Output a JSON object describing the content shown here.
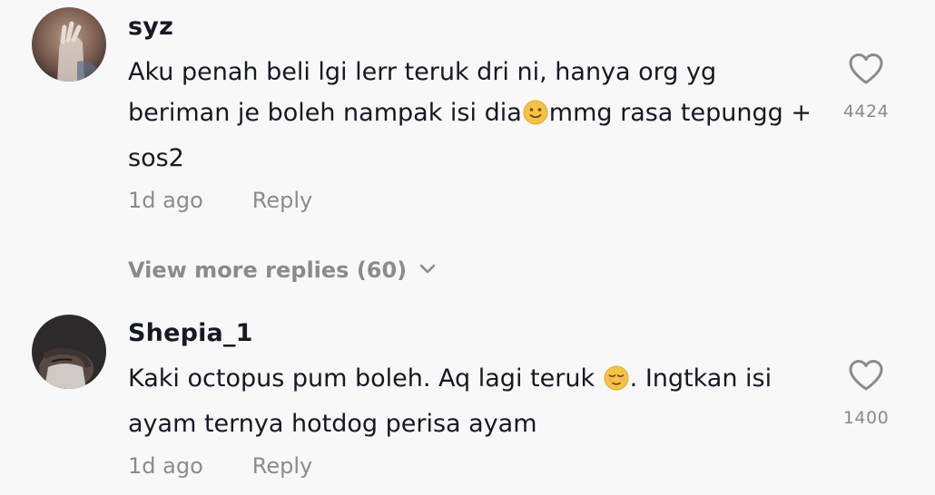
{
  "comments": [
    {
      "username": "syz",
      "text_before_emoji": "Aku penah beli lgi lerr teruk dri ni, hanya org yg beriman je boleh nampak isi dia",
      "emoji": "slightly-smiling-face",
      "text_after_emoji": "mmg rasa tepungg + sos2",
      "time": "1d ago",
      "reply_label": "Reply",
      "likes": "4424",
      "replies_label": "View more replies (60)"
    },
    {
      "username": "Shepia_1",
      "text_before_emoji": "Kaki octopus pum boleh. Aq lagi teruk ",
      "emoji": "relieved-face",
      "text_after_emoji": ". Ingtkan isi ayam ternya hotdog perisa ayam",
      "time": "1d ago",
      "reply_label": "Reply",
      "likes": "1400"
    }
  ],
  "colors": {
    "background": "#f8f8f8",
    "primary_text": "#161823",
    "secondary_text": "#8a8b91",
    "emoji_yellow": "#f5c344"
  }
}
